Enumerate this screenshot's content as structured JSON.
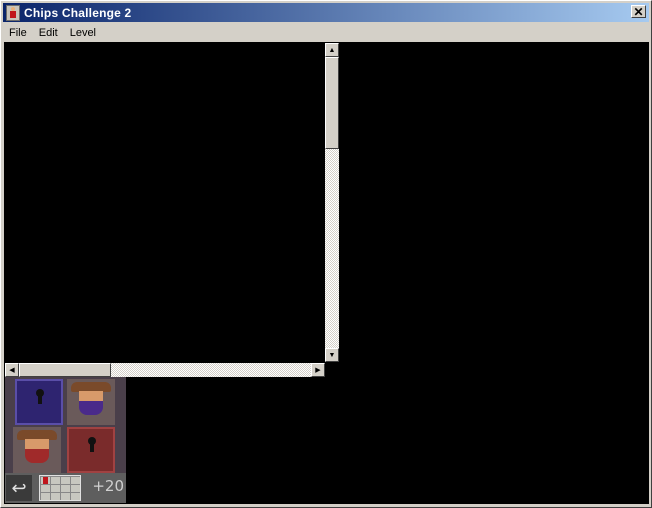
{
  "window": {
    "title": "Chips Challenge 2",
    "close_symbol": "✕"
  },
  "menu": {
    "items": [
      "File",
      "Edit",
      "Level"
    ]
  },
  "scrollbars": {
    "up_arrow": "▲",
    "down_arrow": "▼",
    "left_arrow": "◀",
    "right_arrow": "▶"
  },
  "palette": {
    "tiles": [
      "blue-door",
      "bandit-blue-mask",
      "bandit-red-mask",
      "red-door",
      "hook",
      "grid-floor"
    ],
    "count_label": "+20"
  },
  "colors": {
    "titlebar_start": "#0a246a",
    "titlebar_end": "#a6caf0",
    "canvas": "#000000",
    "chrome": "#d4d0c8"
  }
}
